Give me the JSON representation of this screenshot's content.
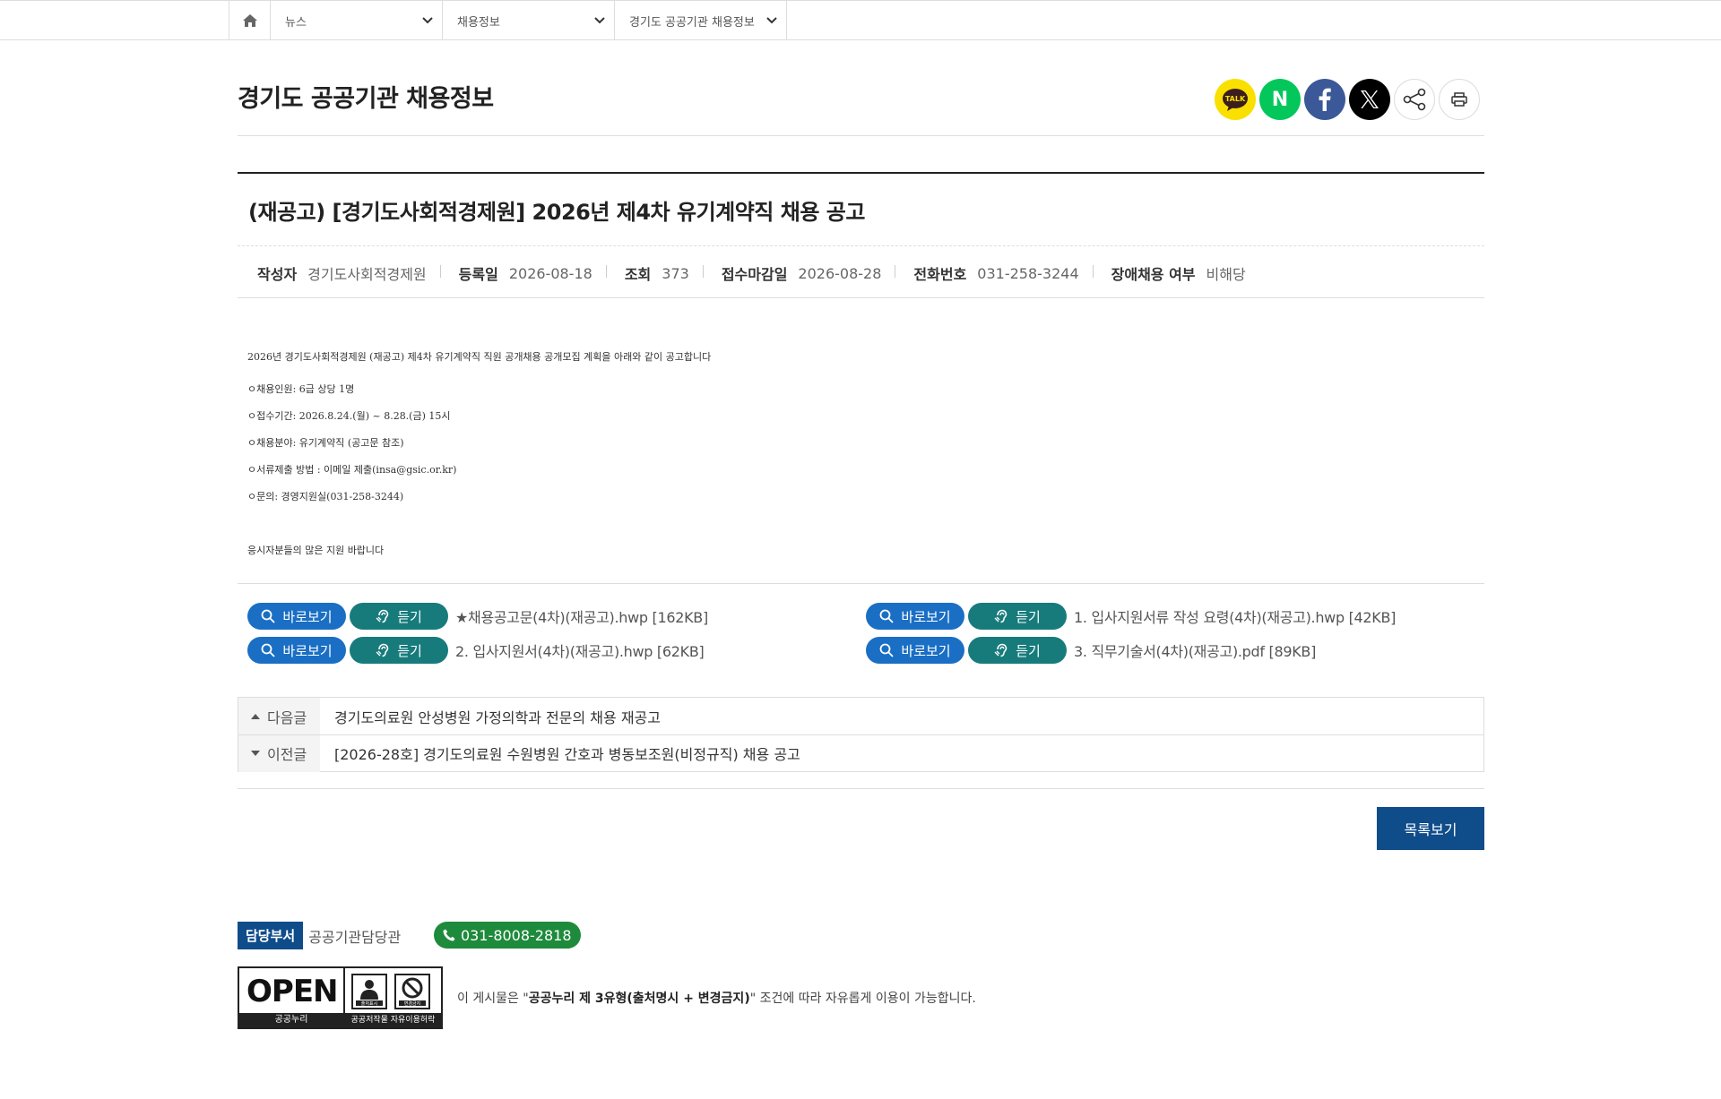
{
  "nav": {
    "home_icon": "home-icon",
    "menus": [
      "뉴스",
      "채용정보",
      "경기도 공공기관 채용정보"
    ]
  },
  "page_title": "경기도 공공기관 채용정보",
  "share": [
    "kakao-talk",
    "naver",
    "facebook",
    "x",
    "share",
    "print"
  ],
  "share_labels": {
    "kakao": "TALK",
    "naver": "N"
  },
  "article": {
    "title": "(재공고) [경기도사회적경제원] 2026년 제4차 유기계약직 채용 공고",
    "meta": [
      {
        "key": "작성자",
        "value": "경기도사회적경제원"
      },
      {
        "key": "등록일",
        "value": "2026-08-18"
      },
      {
        "key": "조회",
        "value": "373"
      },
      {
        "key": "접수마감일",
        "value": "2026-08-28"
      },
      {
        "key": "전화번호",
        "value": "031-258-3244"
      },
      {
        "key": "장애채용 여부",
        "value": "비해당"
      }
    ],
    "body": {
      "intro": "2026년 경기도사회적경제원 (재공고) 제4차 유기계약직 직원 공개채용 공개모집 계획을 아래와 같이 공고합니다",
      "items": [
        "ㅇ채용인원: 6급 상당 1명",
        "ㅇ접수기간: 2026.8.24.(월) ~ 8.28.(금) 15시",
        "ㅇ채용분야: 유기계약직 (공고문 참조)",
        "ㅇ서류제출 방법 : 이메일 제출(insa@gsic.or.kr)",
        "ㅇ문의: 경영지원실(031-258-3244)"
      ],
      "closing": "응시자분들의 많은 지원 바랍니다"
    }
  },
  "attachments": {
    "view_label": "바로보기",
    "listen_label": "듣기",
    "files": [
      "★채용공고문(4차)(재공고).hwp [162KB]",
      "1. 입사지원서류 작성 요령(4차)(재공고).hwp [42KB]",
      "2. 입사지원서(4차)(재공고).hwp [62KB]",
      "3. 직무기술서(4차)(재공고).pdf [89KB]"
    ]
  },
  "prev_next": {
    "next_label": "다음글",
    "next_title": "경기도의료원 안성병원 가정의학과 전문의 채용 재공고",
    "prev_label": "이전글",
    "prev_title": "[2026-28호] 경기도의료원 수원병원 간호과 병동보조원(비정규직) 채용 공고"
  },
  "list_button": "목록보기",
  "footer": {
    "dept_tag": "담당부서",
    "dept_name": "공공기관담당관",
    "phone": "031-8008-2818",
    "license": {
      "open_word": "OPEN",
      "open_caption": "공공누리",
      "icon1_caption": "출처표시",
      "icon2_caption": "변경금지",
      "right_caption": "공공저작물 자유이용허락",
      "text_prefix": "이 게시물은 \"",
      "text_bold": "공공누리 제 3유형(출처명시 + 변경금지)",
      "text_suffix": "\" 조건에 따라 자유롭게 이용이 가능합니다."
    }
  },
  "colors": {
    "view_btn": "#1a6fc4",
    "listen_btn": "#177b7c",
    "primary_navy": "#0f4c8a",
    "phone_green": "#1e8a3b"
  }
}
